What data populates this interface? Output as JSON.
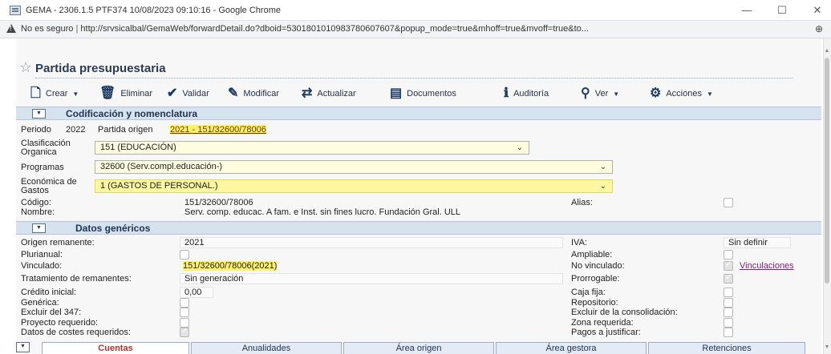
{
  "window": {
    "title": "GEMA - 2306.1.5 PTF374 10/08/2023 09:10:16 - Google Chrome",
    "min": "—",
    "max": "☐",
    "close": "✕"
  },
  "address": {
    "security": "No es seguro",
    "separator": "|",
    "url": "http://srvsicalbal/GemaWeb/forwardDetail.do?dboid=5301801010983780607607&popup_mode=true&mhoff=true&mvoff=true&to..."
  },
  "page": {
    "title": "Partida presupuestaria"
  },
  "toolbar": {
    "crear": "Crear",
    "eliminar": "Eliminar",
    "validar": "Validar",
    "modificar": "Modificar",
    "actualizar": "Actualizar",
    "documentos": "Documentos",
    "auditoria": "Auditoría",
    "ver": "Ver",
    "acciones": "Acciones"
  },
  "codificacion": {
    "section_title": "Codificación y nomenclatura",
    "periodo_label": "Periodo",
    "periodo_value": "2022",
    "partida_origen_label": "Partida origen",
    "partida_origen_value": "2021 - 151/32600/78006",
    "clasificacion_label_1": "Clasificación",
    "clasificacion_label_2": "Organica",
    "clasificacion_value": "151 (EDUCACIÓN)",
    "programas_label": "Programas",
    "programas_value": "32600 (Serv.compl.educación-)",
    "economica_label_1": "Económica de",
    "economica_label_2": "Gastos",
    "economica_value": "1 (GASTOS DE PERSONAL.)",
    "codigo_label": "Código:",
    "codigo_value": "151/32600/78006",
    "nombre_label": "Nombre:",
    "nombre_value": "Serv. comp. educac. A fam. e Inst. sin fines lucro. Fundación Gral. ULL",
    "alias_label": "Alias:"
  },
  "genericos": {
    "section_title": "Datos genéricos",
    "origen_label": "Origen remanente:",
    "origen_value": "2021",
    "plurianual_label": "Plurianual:",
    "vinculado_label": "Vinculado:",
    "vinculado_value": "151/32600/78006(2021)",
    "tratamiento_label": "Tratamiento de remanentes:",
    "tratamiento_value": "Sin generación",
    "credito_label": "Crédito inicial:",
    "credito_value": "0,00",
    "generica_label": "Genérica:",
    "excluir347_label": "Excluir del 347:",
    "proyecto_label": "Proyecto requerido:",
    "costes_label": "Datos de costes requeridos:",
    "iva_label": "IVA:",
    "iva_value": "Sin definir",
    "ampliable_label": "Ampliable:",
    "novinculado_label": "No vinculado:",
    "vinculaciones_link": "Vinculaciones",
    "prorrogable_label": "Prorrogable:",
    "cajafija_label": "Caja fija:",
    "repositorio_label": "Repositorio:",
    "excluirconsol_label": "Excluir de la consolidación:",
    "zona_label": "Zona requerida:",
    "pagos_label": "Pagos a justificar:"
  },
  "tabs": [
    "Cuentas",
    "Anualidades",
    "Área origen",
    "Área gestora",
    "Retenciones"
  ],
  "colors": {
    "highlight": "#fdf06a",
    "section_bg": "#d7e2ef",
    "active_tab_text": "#b0322a",
    "link": "#7b1e7a"
  }
}
